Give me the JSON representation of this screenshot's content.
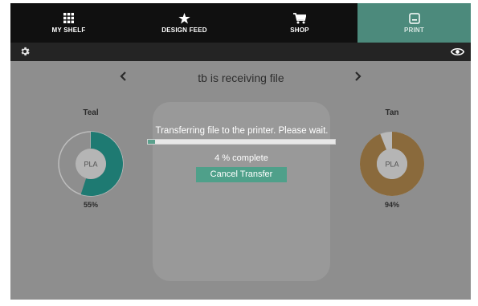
{
  "nav": {
    "items": [
      {
        "label": "MY SHELF",
        "icon": "grid-icon"
      },
      {
        "label": "DESIGN FEED",
        "icon": "star-icon"
      },
      {
        "label": "SHOP",
        "icon": "cart-icon"
      },
      {
        "label": "PRINT",
        "icon": "printer-icon",
        "active": true
      }
    ],
    "active_color": "#4c8a7c"
  },
  "toolbar": {
    "settings_icon": "gear-icon",
    "view_icon": "eye-icon"
  },
  "printer": {
    "title": "tb is receiving file",
    "prev_icon": "chevron-left-icon",
    "next_icon": "chevron-right-icon"
  },
  "spools": {
    "left": {
      "name": "Teal",
      "material": "PLA",
      "percent_label": "55%",
      "level": 0.55,
      "color": "#1e7a72"
    },
    "right": {
      "name": "Tan",
      "material": "PLA",
      "percent_label": "94%",
      "level": 0.94,
      "color": "#8a6a3c"
    }
  },
  "transfer": {
    "message": "Transferring file to the printer. Please wait.",
    "progress": 0.04,
    "progress_text": "4 % complete",
    "cancel_label": "Cancel Transfer"
  }
}
